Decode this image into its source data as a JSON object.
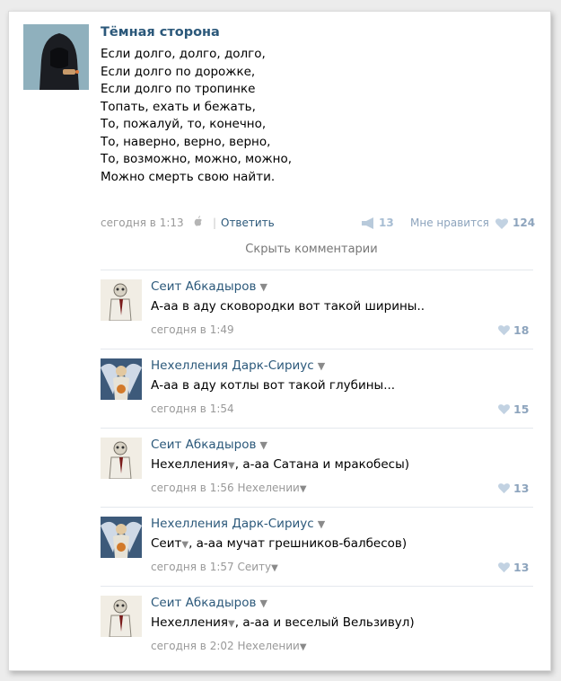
{
  "post": {
    "author": "Тёмная сторона",
    "lines": [
      "Если долго, долго, долго,",
      "Если долго по дорожке,",
      "Если долго по тропинке",
      "Топать, ехать и бежать,",
      "То, пожалуй, то, конечно,",
      "То, наверно, верно, верно,",
      "То, возможно, можно, можно,",
      "Можно смерть свою найти."
    ],
    "time": "сегодня в 1:13",
    "separator": "|",
    "reply_label": "Ответить",
    "shares": "13",
    "likes_label": "Мне нравится",
    "likes": "124",
    "device_icon": "apple-icon"
  },
  "hide_comments_label": "Скрыть комментарии",
  "comments": [
    {
      "author": "Сеит Абкадыров",
      "mention": "",
      "text": "А-аа в аду сковородки вот такой ширины..",
      "time": "сегодня в 1:49",
      "reply_to": "",
      "likes": "18",
      "avatar": "skeleton-avatar"
    },
    {
      "author": "Нехелления Дарк-Сириус",
      "mention": "",
      "text": "А-аа в аду котлы вот такой глубины...",
      "time": "сегодня в 1:54",
      "reply_to": "",
      "likes": "15",
      "avatar": "angel-avatar"
    },
    {
      "author": "Сеит Абкадыров",
      "mention": "Нехелления",
      "text": ", а-аа Сатана и мракобесы)",
      "time": "сегодня в 1:56",
      "reply_to": "Нехелении",
      "likes": "13",
      "avatar": "skeleton-avatar"
    },
    {
      "author": "Нехелления Дарк-Сириус",
      "mention": "Сеит",
      "text": ", а-аа мучат грешников-балбесов)",
      "time": "сегодня в 1:57",
      "reply_to": "Сеиту",
      "likes": "13",
      "avatar": "angel-avatar"
    },
    {
      "author": "Сеит Абкадыров",
      "mention": "Нехелления",
      "text": ", а-аа и веселый Вельзивул)",
      "time": "сегодня в 2:02",
      "reply_to": "Нехелении",
      "likes": "",
      "avatar": "skeleton-avatar"
    }
  ],
  "colors": {
    "link": "#2b587a",
    "meta": "#999999",
    "like": "#8da4bd",
    "divider": "#e4e8ed"
  }
}
